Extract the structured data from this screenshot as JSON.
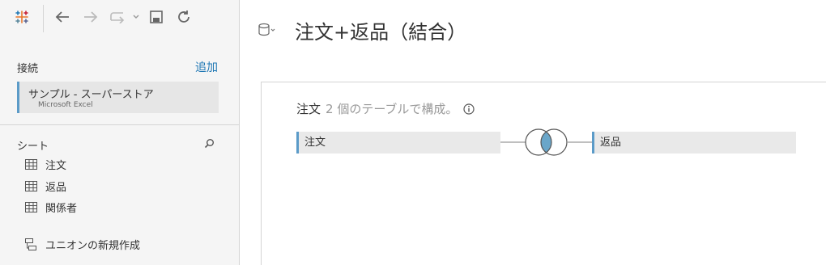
{
  "toolbar": {
    "icons": [
      "tableau-logo-icon",
      "back-arrow-icon",
      "forward-arrow-icon",
      "redo-icon",
      "dropdown-caret-icon",
      "save-icon",
      "refresh-icon"
    ]
  },
  "connections": {
    "header": "接続",
    "add_label": "追加",
    "items": [
      {
        "name": "サンプル - スーパーストア",
        "type": "Microsoft Excel"
      }
    ]
  },
  "sheets": {
    "header": "シート",
    "items": [
      {
        "label": "注文",
        "icon": "table-icon"
      },
      {
        "label": "返品",
        "icon": "table-icon"
      },
      {
        "label": "関係者",
        "icon": "table-icon"
      }
    ],
    "new_union_label": "ユニオンの新規作成"
  },
  "datasource": {
    "title": "注文+返品（結合）"
  },
  "canvas": {
    "caption_name": "注文",
    "caption_desc": "2 個のテーブルで構成。",
    "left_table": "注文",
    "right_table": "返品",
    "join_type": "inner",
    "colors": {
      "accent": "#5b9bc8",
      "join_fill": "#6aa6c9"
    }
  }
}
